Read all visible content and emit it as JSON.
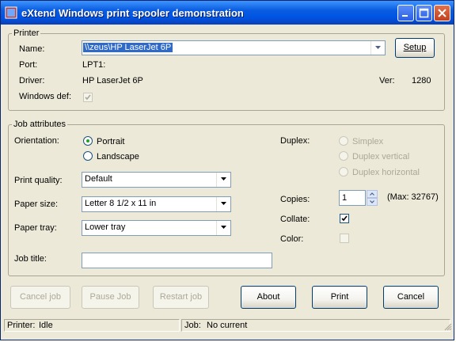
{
  "window": {
    "title": "eXtend Windows print spooler demonstration",
    "icon": "printer-app-icon",
    "controls": [
      "minimize-icon",
      "maximize-icon",
      "close-icon"
    ]
  },
  "printer": {
    "legend": "Printer",
    "name_label": "Name:",
    "name_value": "\\\\zeus\\HP LaserJet 6P",
    "setup_label": "Setup",
    "port_label": "Port:",
    "port_value": "LPT1:",
    "driver_label": "Driver:",
    "driver_value": "HP LaserJet 6P",
    "ver_label": "Ver:",
    "ver_value": "1280",
    "windows_def_label": "Windows def:",
    "windows_def_checked": true
  },
  "job": {
    "legend": "Job attributes",
    "orientation_label": "Orientation:",
    "orientation_options": [
      "Portrait",
      "Landscape"
    ],
    "orientation_selected": "Portrait",
    "print_quality_label": "Print quality:",
    "print_quality_value": "Default",
    "paper_size_label": "Paper size:",
    "paper_size_value": "Letter 8 1/2 x 11 in",
    "paper_tray_label": "Paper tray:",
    "paper_tray_value": "Lower tray",
    "job_title_label": "Job title:",
    "job_title_value": "",
    "duplex_label": "Duplex:",
    "duplex_options": [
      "Simplex",
      "Duplex vertical",
      "Duplex horizontal"
    ],
    "copies_label": "Copies:",
    "copies_value": "1",
    "copies_max": "(Max: 32767)",
    "collate_label": "Collate:",
    "collate_checked": true,
    "color_label": "Color:",
    "color_checked": false
  },
  "buttons": {
    "cancel_job": "Cancel job",
    "pause_job": "Pause Job",
    "restart_job": "Restart job",
    "about": "About",
    "print": "Print",
    "cancel": "Cancel"
  },
  "statusbar": {
    "printer_label": "Printer:",
    "printer_value": "Idle",
    "job_label": "Job:",
    "job_value": "No current"
  },
  "colors": {
    "titlebar": "#0054e3",
    "dialog_bg": "#ece9d8",
    "selection": "#316ac5",
    "check_mark": "#21a121"
  }
}
